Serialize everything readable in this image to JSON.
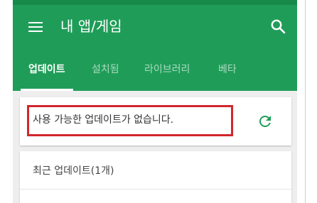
{
  "app_bar": {
    "title": "내 앱/게임",
    "menu_icon": "hamburger-menu-icon",
    "search_icon": "search-icon",
    "color": "#1f9d58"
  },
  "tabs": [
    {
      "label": "업데이트",
      "active": true
    },
    {
      "label": "설치됨",
      "active": false
    },
    {
      "label": "라이브러리",
      "active": false
    },
    {
      "label": "베타",
      "active": false
    }
  ],
  "updates_card": {
    "message": "사용 가능한 업데이트가 없습니다.",
    "refresh_icon": "refresh-icon",
    "refresh_color": "#1f9d58",
    "highlight_color": "#d0262c"
  },
  "recent_card": {
    "title": "최근 업데이트(1개)"
  }
}
